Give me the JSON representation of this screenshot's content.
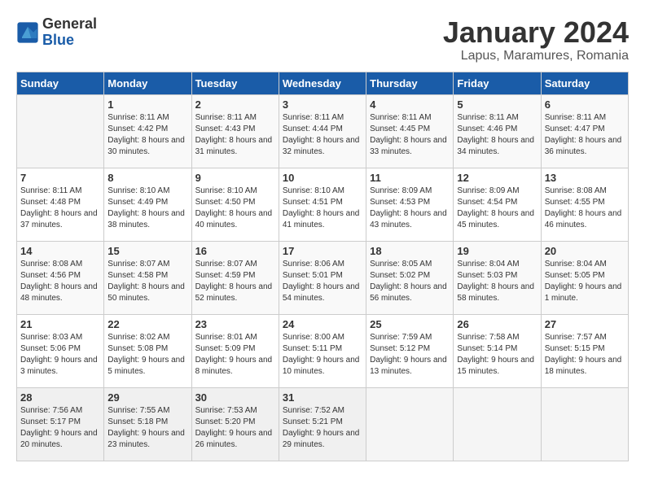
{
  "header": {
    "logo_line1": "General",
    "logo_line2": "Blue",
    "title": "January 2024",
    "subtitle": "Lapus, Maramures, Romania"
  },
  "weekdays": [
    "Sunday",
    "Monday",
    "Tuesday",
    "Wednesday",
    "Thursday",
    "Friday",
    "Saturday"
  ],
  "weeks": [
    [
      {
        "day": "",
        "sunrise": "",
        "sunset": "",
        "daylight": ""
      },
      {
        "day": "1",
        "sunrise": "Sunrise: 8:11 AM",
        "sunset": "Sunset: 4:42 PM",
        "daylight": "Daylight: 8 hours and 30 minutes."
      },
      {
        "day": "2",
        "sunrise": "Sunrise: 8:11 AM",
        "sunset": "Sunset: 4:43 PM",
        "daylight": "Daylight: 8 hours and 31 minutes."
      },
      {
        "day": "3",
        "sunrise": "Sunrise: 8:11 AM",
        "sunset": "Sunset: 4:44 PM",
        "daylight": "Daylight: 8 hours and 32 minutes."
      },
      {
        "day": "4",
        "sunrise": "Sunrise: 8:11 AM",
        "sunset": "Sunset: 4:45 PM",
        "daylight": "Daylight: 8 hours and 33 minutes."
      },
      {
        "day": "5",
        "sunrise": "Sunrise: 8:11 AM",
        "sunset": "Sunset: 4:46 PM",
        "daylight": "Daylight: 8 hours and 34 minutes."
      },
      {
        "day": "6",
        "sunrise": "Sunrise: 8:11 AM",
        "sunset": "Sunset: 4:47 PM",
        "daylight": "Daylight: 8 hours and 36 minutes."
      }
    ],
    [
      {
        "day": "7",
        "sunrise": "Sunrise: 8:11 AM",
        "sunset": "Sunset: 4:48 PM",
        "daylight": "Daylight: 8 hours and 37 minutes."
      },
      {
        "day": "8",
        "sunrise": "Sunrise: 8:10 AM",
        "sunset": "Sunset: 4:49 PM",
        "daylight": "Daylight: 8 hours and 38 minutes."
      },
      {
        "day": "9",
        "sunrise": "Sunrise: 8:10 AM",
        "sunset": "Sunset: 4:50 PM",
        "daylight": "Daylight: 8 hours and 40 minutes."
      },
      {
        "day": "10",
        "sunrise": "Sunrise: 8:10 AM",
        "sunset": "Sunset: 4:51 PM",
        "daylight": "Daylight: 8 hours and 41 minutes."
      },
      {
        "day": "11",
        "sunrise": "Sunrise: 8:09 AM",
        "sunset": "Sunset: 4:53 PM",
        "daylight": "Daylight: 8 hours and 43 minutes."
      },
      {
        "day": "12",
        "sunrise": "Sunrise: 8:09 AM",
        "sunset": "Sunset: 4:54 PM",
        "daylight": "Daylight: 8 hours and 45 minutes."
      },
      {
        "day": "13",
        "sunrise": "Sunrise: 8:08 AM",
        "sunset": "Sunset: 4:55 PM",
        "daylight": "Daylight: 8 hours and 46 minutes."
      }
    ],
    [
      {
        "day": "14",
        "sunrise": "Sunrise: 8:08 AM",
        "sunset": "Sunset: 4:56 PM",
        "daylight": "Daylight: 8 hours and 48 minutes."
      },
      {
        "day": "15",
        "sunrise": "Sunrise: 8:07 AM",
        "sunset": "Sunset: 4:58 PM",
        "daylight": "Daylight: 8 hours and 50 minutes."
      },
      {
        "day": "16",
        "sunrise": "Sunrise: 8:07 AM",
        "sunset": "Sunset: 4:59 PM",
        "daylight": "Daylight: 8 hours and 52 minutes."
      },
      {
        "day": "17",
        "sunrise": "Sunrise: 8:06 AM",
        "sunset": "Sunset: 5:01 PM",
        "daylight": "Daylight: 8 hours and 54 minutes."
      },
      {
        "day": "18",
        "sunrise": "Sunrise: 8:05 AM",
        "sunset": "Sunset: 5:02 PM",
        "daylight": "Daylight: 8 hours and 56 minutes."
      },
      {
        "day": "19",
        "sunrise": "Sunrise: 8:04 AM",
        "sunset": "Sunset: 5:03 PM",
        "daylight": "Daylight: 8 hours and 58 minutes."
      },
      {
        "day": "20",
        "sunrise": "Sunrise: 8:04 AM",
        "sunset": "Sunset: 5:05 PM",
        "daylight": "Daylight: 9 hours and 1 minute."
      }
    ],
    [
      {
        "day": "21",
        "sunrise": "Sunrise: 8:03 AM",
        "sunset": "Sunset: 5:06 PM",
        "daylight": "Daylight: 9 hours and 3 minutes."
      },
      {
        "day": "22",
        "sunrise": "Sunrise: 8:02 AM",
        "sunset": "Sunset: 5:08 PM",
        "daylight": "Daylight: 9 hours and 5 minutes."
      },
      {
        "day": "23",
        "sunrise": "Sunrise: 8:01 AM",
        "sunset": "Sunset: 5:09 PM",
        "daylight": "Daylight: 9 hours and 8 minutes."
      },
      {
        "day": "24",
        "sunrise": "Sunrise: 8:00 AM",
        "sunset": "Sunset: 5:11 PM",
        "daylight": "Daylight: 9 hours and 10 minutes."
      },
      {
        "day": "25",
        "sunrise": "Sunrise: 7:59 AM",
        "sunset": "Sunset: 5:12 PM",
        "daylight": "Daylight: 9 hours and 13 minutes."
      },
      {
        "day": "26",
        "sunrise": "Sunrise: 7:58 AM",
        "sunset": "Sunset: 5:14 PM",
        "daylight": "Daylight: 9 hours and 15 minutes."
      },
      {
        "day": "27",
        "sunrise": "Sunrise: 7:57 AM",
        "sunset": "Sunset: 5:15 PM",
        "daylight": "Daylight: 9 hours and 18 minutes."
      }
    ],
    [
      {
        "day": "28",
        "sunrise": "Sunrise: 7:56 AM",
        "sunset": "Sunset: 5:17 PM",
        "daylight": "Daylight: 9 hours and 20 minutes."
      },
      {
        "day": "29",
        "sunrise": "Sunrise: 7:55 AM",
        "sunset": "Sunset: 5:18 PM",
        "daylight": "Daylight: 9 hours and 23 minutes."
      },
      {
        "day": "30",
        "sunrise": "Sunrise: 7:53 AM",
        "sunset": "Sunset: 5:20 PM",
        "daylight": "Daylight: 9 hours and 26 minutes."
      },
      {
        "day": "31",
        "sunrise": "Sunrise: 7:52 AM",
        "sunset": "Sunset: 5:21 PM",
        "daylight": "Daylight: 9 hours and 29 minutes."
      },
      {
        "day": "",
        "sunrise": "",
        "sunset": "",
        "daylight": ""
      },
      {
        "day": "",
        "sunrise": "",
        "sunset": "",
        "daylight": ""
      },
      {
        "day": "",
        "sunrise": "",
        "sunset": "",
        "daylight": ""
      }
    ]
  ]
}
